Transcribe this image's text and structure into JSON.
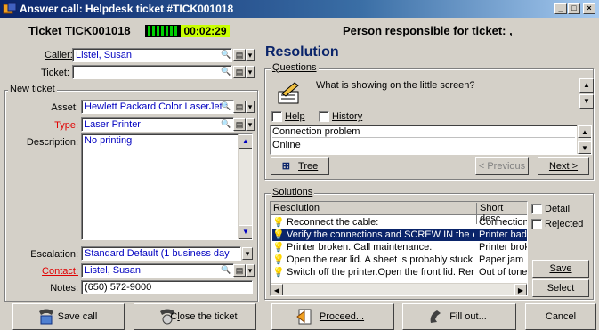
{
  "window": {
    "title": "Answer call: Helpdesk ticket #TICK001018"
  },
  "header": {
    "ticket_title": "Ticket TICK001018",
    "timer": "00:02:29",
    "responsible": "Person responsible for ticket: ,"
  },
  "caller": {
    "label": "Caller:",
    "value": "Listel, Susan"
  },
  "ticket": {
    "label": "Ticket:",
    "value": ""
  },
  "new_ticket": {
    "group_label": "New ticket",
    "asset": {
      "label": "Asset:",
      "value": "Hewlett Packard Color LaserJet :"
    },
    "type": {
      "label": "Type:",
      "value": "Laser Printer"
    },
    "description": {
      "label": "Description:",
      "value": "No printing"
    },
    "escalation": {
      "label": "Escalation:",
      "value": "Standard Default (1 business day"
    },
    "contact": {
      "label": "Contact:",
      "value": "Listel, Susan"
    },
    "notes": {
      "label": "Notes:",
      "value": "(650) 572-9000"
    }
  },
  "resolution": {
    "title": "Resolution",
    "questions": {
      "group_label": "Questions",
      "question_text": "What is showing on the little screen?",
      "help_label": "Help",
      "history_label": "History",
      "answers": [
        "Connection problem",
        "Online"
      ],
      "tree_label": "Tree",
      "previous_label": "< Previous",
      "next_label": "Next >"
    },
    "solutions": {
      "group_label": "Solutions",
      "columns": [
        "Resolution",
        "Short desc."
      ],
      "rows": [
        {
          "resolution": "Reconnect the cable:",
          "short": "Connection",
          "selected": false
        },
        {
          "resolution": "Verify the connections and SCREW IN the c...",
          "short": "Printer badly",
          "selected": true
        },
        {
          "resolution": "Printer broken. Call maintenance.",
          "short": "Printer broke",
          "selected": false
        },
        {
          "resolution": "Open the rear lid. A sheet is probably stuck....",
          "short": "Paper jam",
          "selected": false
        },
        {
          "resolution": "Switch off the printer.Open the front lid. Rem...",
          "short": "Out of toner",
          "selected": false
        }
      ],
      "detail_label": "Detail",
      "rejected_label": "Rejected",
      "save_label": "Save",
      "select_label": "Select"
    }
  },
  "footer": {
    "save_call": "Save call",
    "close_ticket": "Close the ticket",
    "proceed": "Proceed...",
    "fill_out": "Fill out...",
    "cancel": "Cancel"
  },
  "colors": {
    "title_bar": "#0a246a",
    "selection": "#0a246a",
    "timer_bg": "#c8ff00",
    "required_label": "#e00000",
    "link_value": "#0000c0"
  }
}
